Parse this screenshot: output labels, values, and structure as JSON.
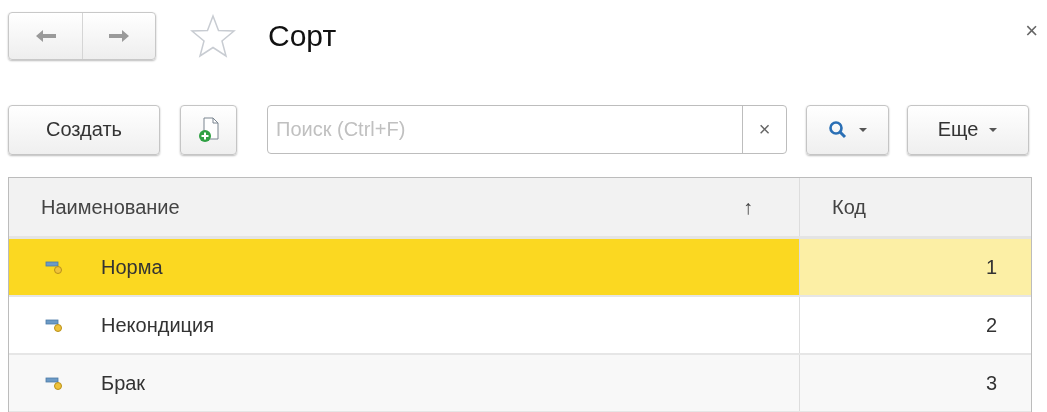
{
  "window": {
    "title": "Сорт",
    "close": "×"
  },
  "toolbar": {
    "create": "Создать",
    "search": {
      "placeholder": "Поиск (Ctrl+F)",
      "clear": "×"
    },
    "more": "Еще"
  },
  "table": {
    "columns": [
      {
        "label": "Наименование",
        "sort_mark": "↑"
      },
      {
        "label": "Код"
      }
    ],
    "rows": [
      {
        "name": "Норма",
        "code": "1",
        "selected": true
      },
      {
        "name": "Некондиция",
        "code": "2",
        "selected": false
      },
      {
        "name": "Брак",
        "code": "3",
        "selected": false
      }
    ]
  }
}
